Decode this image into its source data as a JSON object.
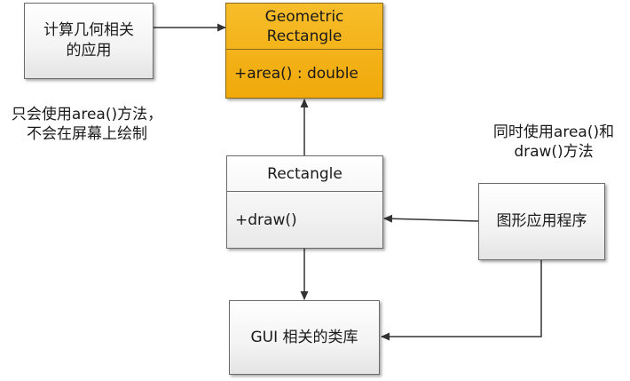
{
  "nodes": {
    "geometry_app": "计算几何相关\n的应用",
    "geometric_rectangle": {
      "name": "Geometric\nRectangle",
      "method": "+area() : double"
    },
    "rectangle": {
      "name": "Rectangle",
      "method": "+draw()"
    },
    "graphics_app": "图形应用程序",
    "gui_library": "GUI 相关的类库"
  },
  "notes": {
    "geometry_note": "只会使用area()方法，\n不会在屏幕上绘制",
    "graphics_note": "同时使用area()和\ndraw()方法"
  },
  "colors": {
    "highlight": "#f0a90a",
    "line": "#333333"
  }
}
